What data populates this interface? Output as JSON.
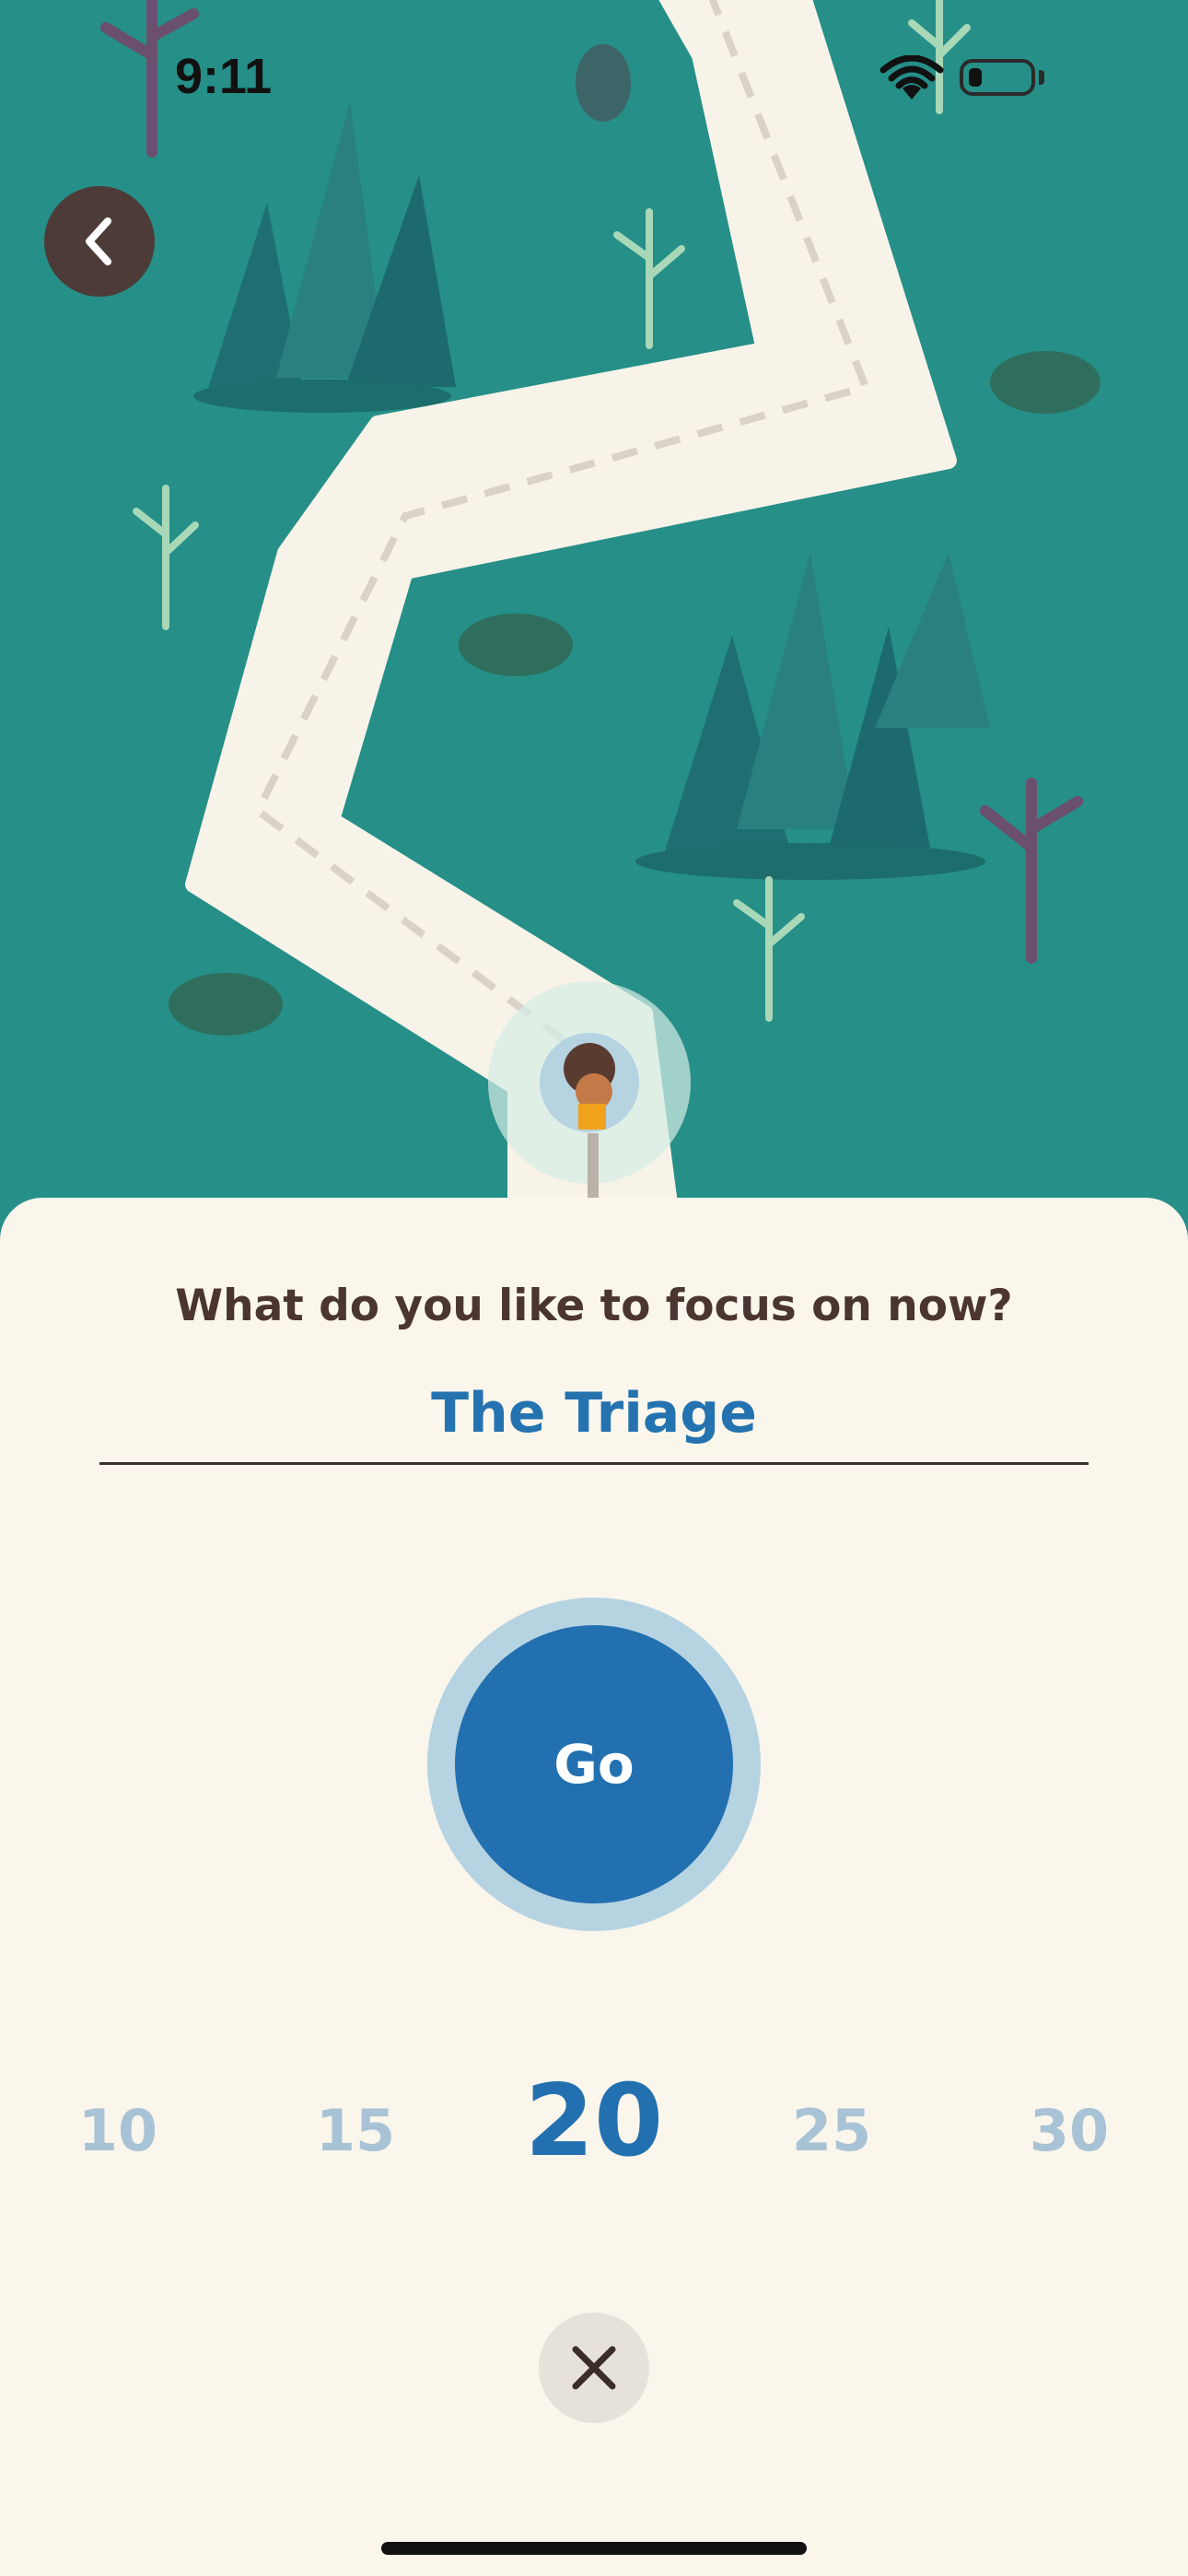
{
  "status_bar": {
    "time": "9:11",
    "icons": [
      "wifi-icon",
      "battery-icon"
    ]
  },
  "navigation": {
    "back_icon": "chevron-left-icon"
  },
  "map": {
    "avatar_icon": "hiker-avatar-icon",
    "colors": {
      "grass": "#258f88",
      "path": "#f7f3e8",
      "trees": "#1f6f72",
      "bare_trees": "#6b4f6e"
    }
  },
  "sheet": {
    "prompt": "What do you like to focus on now?",
    "focus_value": "The Triage",
    "go_label": "Go",
    "durations": [
      "10",
      "15",
      "20",
      "25",
      "30"
    ],
    "selected_duration": "20",
    "close_icon": "close-icon",
    "colors": {
      "accent": "#2270b0",
      "ring": "#b6d3e2",
      "muted": "#a9c3d6",
      "sheet_bg": "#faf6ec",
      "text": "#4a3530"
    }
  }
}
